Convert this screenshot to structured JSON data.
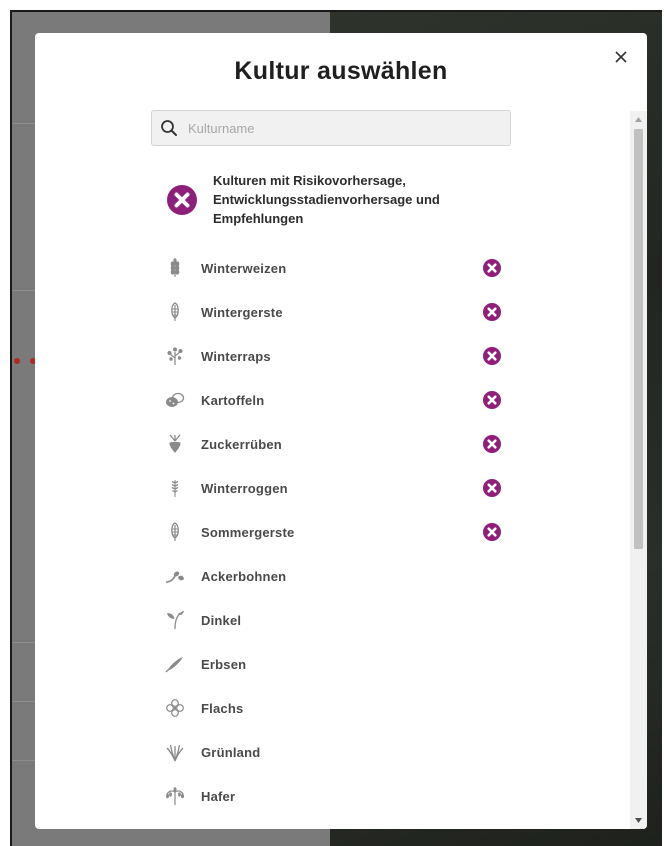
{
  "modal": {
    "title": "Kultur auswählen",
    "close_glyph": "×",
    "search": {
      "placeholder": "Kulturname",
      "value": ""
    },
    "legend": {
      "text": "Kulturen mit Risikovorhersage, Entwicklungsstadienvorhersage und Empfehlungen",
      "icon": "forecast-badge-icon"
    },
    "crops": [
      {
        "label": "Winterweizen",
        "icon": "wheat-icon",
        "has_forecast": true
      },
      {
        "label": "Wintergerste",
        "icon": "barley-icon",
        "has_forecast": true
      },
      {
        "label": "Winterraps",
        "icon": "rapeseed-icon",
        "has_forecast": true
      },
      {
        "label": "Kartoffeln",
        "icon": "potato-icon",
        "has_forecast": true
      },
      {
        "label": "Zuckerrüben",
        "icon": "sugarbeet-icon",
        "has_forecast": true
      },
      {
        "label": "Winterroggen",
        "icon": "rye-icon",
        "has_forecast": true
      },
      {
        "label": "Sommergerste",
        "icon": "barley-icon",
        "has_forecast": true
      },
      {
        "label": "Ackerbohnen",
        "icon": "bean-icon",
        "has_forecast": false
      },
      {
        "label": "Dinkel",
        "icon": "sprout-icon",
        "has_forecast": false
      },
      {
        "label": "Erbsen",
        "icon": "pea-icon",
        "has_forecast": false
      },
      {
        "label": "Flachs",
        "icon": "flax-icon",
        "has_forecast": false
      },
      {
        "label": "Grünland",
        "icon": "grass-icon",
        "has_forecast": false
      },
      {
        "label": "Hafer",
        "icon": "oat-icon",
        "has_forecast": false
      }
    ]
  },
  "colors": {
    "accent_purple": "#8e1f7a",
    "icon_gray": "#8a8a8a",
    "text_dark": "#1f1f1f"
  }
}
